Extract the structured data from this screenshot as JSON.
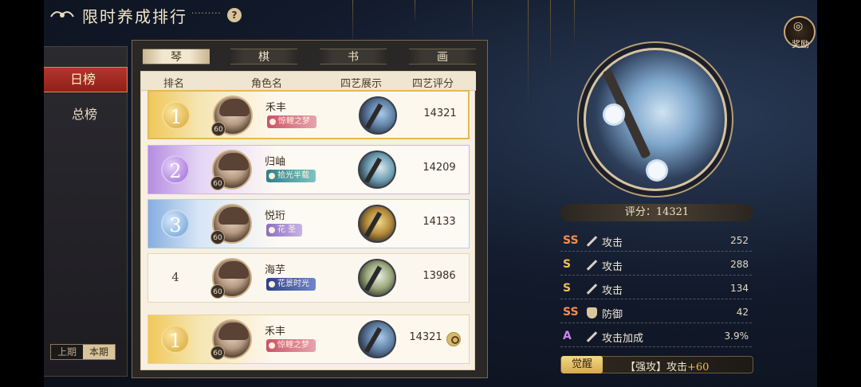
{
  "header": {
    "title": "限时养成排行",
    "dots": "·········",
    "help": "?",
    "reward_label": "奖励",
    "reward_glyph": "◎"
  },
  "side": {
    "tab_daily": "日榜",
    "tab_total": "总榜",
    "period_prev": "上期",
    "period_current": "本期"
  },
  "board": {
    "tabs": [
      "琴",
      "棋",
      "书",
      "画"
    ],
    "active_tab": "琴",
    "headers": {
      "rank": "排名",
      "name": "角色名",
      "show": "四艺展示",
      "score": "四艺评分"
    },
    "rows": [
      {
        "rank": "1",
        "name": "禾丰",
        "level": "60",
        "tag": "惊鲤之梦",
        "score": "14321"
      },
      {
        "rank": "2",
        "name": "归岫",
        "level": "60",
        "tag": "拾光半载",
        "score": "14209"
      },
      {
        "rank": "3",
        "name": "悦珩",
        "level": "60",
        "tag": "花 圣",
        "score": "14133"
      },
      {
        "rank": "4",
        "name": "海芋",
        "level": "60",
        "tag": "花景时光",
        "score": "13986"
      },
      {
        "rank": "1",
        "name": "禾丰",
        "level": "60",
        "tag": "惊鲤之梦",
        "score": "14321"
      }
    ]
  },
  "detail": {
    "score_text": "评分：14321",
    "stats": [
      {
        "grade": "SS",
        "icon": "sword-icon",
        "label": "攻击",
        "value": "252"
      },
      {
        "grade": "S",
        "icon": "sword-icon",
        "label": "攻击",
        "value": "288"
      },
      {
        "grade": "S",
        "icon": "sword-icon",
        "label": "攻击",
        "value": "134"
      },
      {
        "grade": "SS",
        "icon": "shield-icon",
        "label": "防御",
        "value": "42"
      },
      {
        "grade": "A",
        "icon": "sword-icon",
        "label": "攻击加成",
        "value": "3.9%"
      }
    ],
    "awaken_label": "觉醒",
    "awaken_text": "【强攻】攻击",
    "awaken_plus": "+60"
  },
  "colors": {
    "accent_red": "#b2362b",
    "gold": "#e6b94d",
    "grade_ss": "#ff8b4e",
    "grade_s": "#f2c04a",
    "grade_a": "#c985ee"
  }
}
